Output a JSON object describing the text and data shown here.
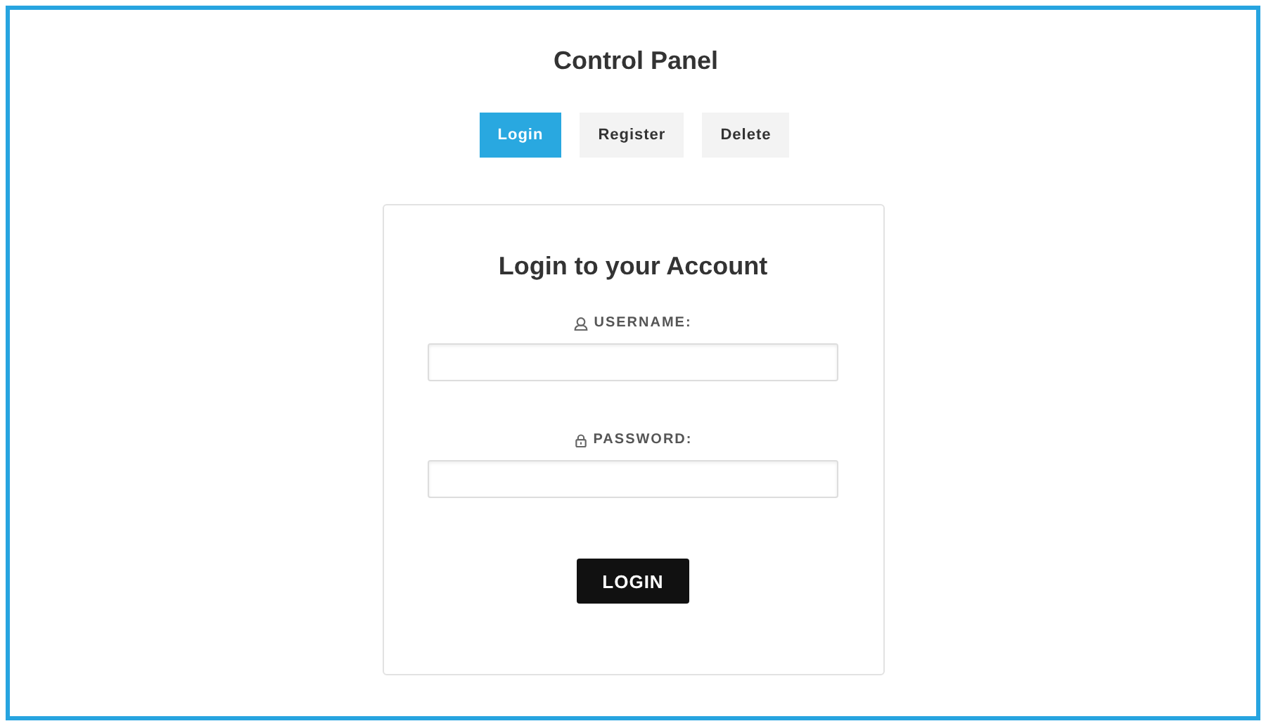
{
  "title": "Control Panel",
  "tabs": [
    {
      "label": "Login",
      "selected": true
    },
    {
      "label": "Register",
      "selected": false
    },
    {
      "label": "Delete",
      "selected": false
    }
  ],
  "form": {
    "heading": "Login to your Account",
    "fields": [
      {
        "kind": "user",
        "label": "USERNAME:"
      },
      {
        "kind": "lock",
        "label": "PASSWORD:"
      }
    ],
    "submit": "LOGIN"
  }
}
